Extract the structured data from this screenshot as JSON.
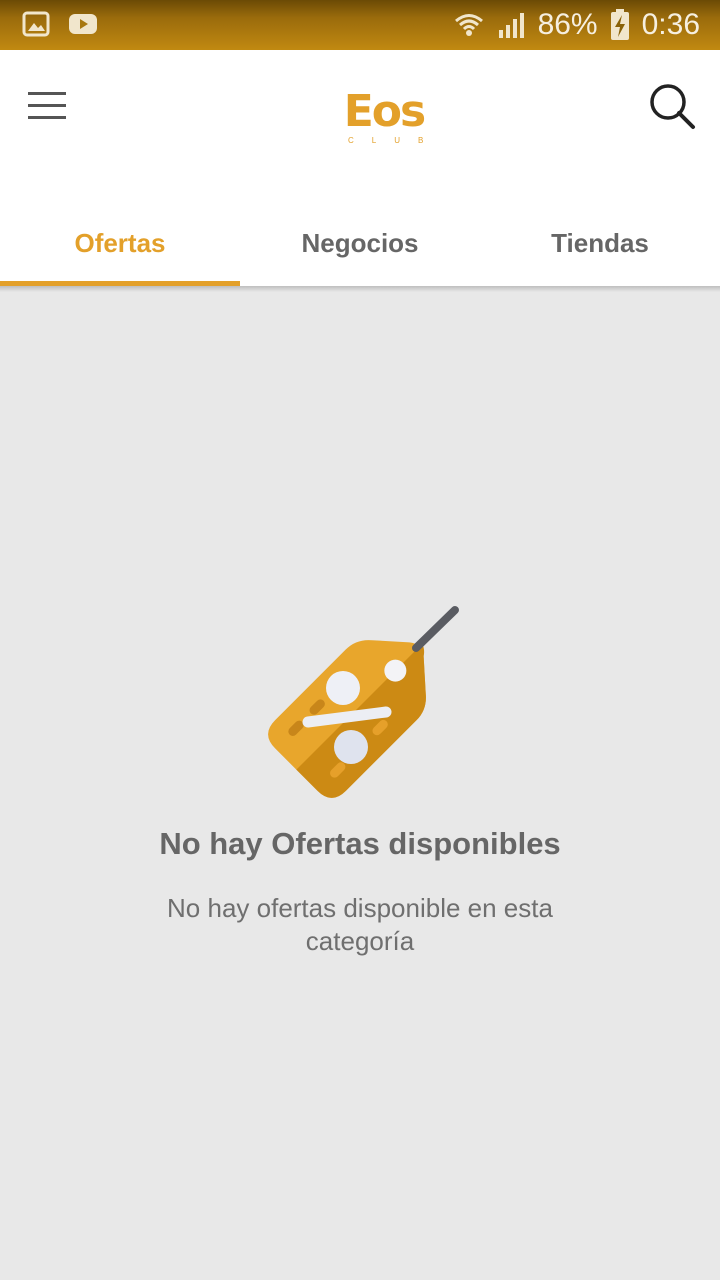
{
  "status_bar": {
    "left_icons": [
      "gallery-icon",
      "youtube-icon"
    ],
    "battery_percent": "86%",
    "time": "0:36",
    "right_icons": [
      "wifi-icon",
      "signal-icon",
      "battery-charging-icon"
    ]
  },
  "app_bar": {
    "logo_text": "Eos",
    "logo_subtext": "CLUB",
    "menu_icon": "hamburger-menu-icon",
    "search_icon": "search-icon"
  },
  "tabs": [
    {
      "label": "Ofertas",
      "active": true
    },
    {
      "label": "Negocios",
      "active": false
    },
    {
      "label": "Tiendas",
      "active": false
    }
  ],
  "empty_state": {
    "icon": "discount-tag-icon",
    "title": "No hay Ofertas disponibles",
    "message": "No hay ofertas disponible en esta categoría"
  },
  "colors": {
    "accent": "#e3a02a",
    "status_bar": "#b07d10",
    "background": "#e8e8e8"
  }
}
